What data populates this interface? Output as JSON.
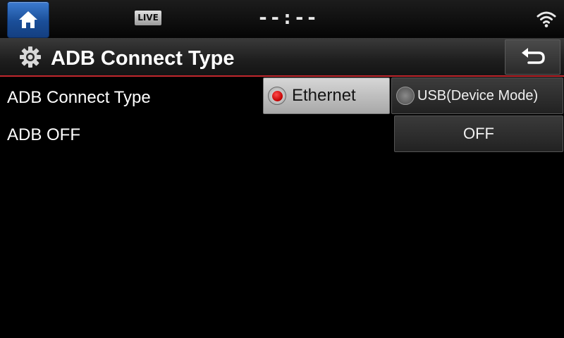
{
  "statusbar": {
    "home_icon": "home-icon",
    "live_badge": "LIVE",
    "clock": "--:--",
    "wifi_icon": "wifi-icon"
  },
  "header": {
    "settings_icon": "gear-icon",
    "title": "ADB Connect Type",
    "back_icon": "back-arrow-icon",
    "accent_color": "#c0272d"
  },
  "settings": {
    "connect_type": {
      "label": "ADB Connect Type",
      "options": [
        {
          "label": "Ethernet",
          "selected": true
        },
        {
          "label": "USB(Device Mode)",
          "selected": false
        }
      ]
    },
    "adb_off": {
      "label": "ADB OFF",
      "button_label": "OFF"
    }
  }
}
